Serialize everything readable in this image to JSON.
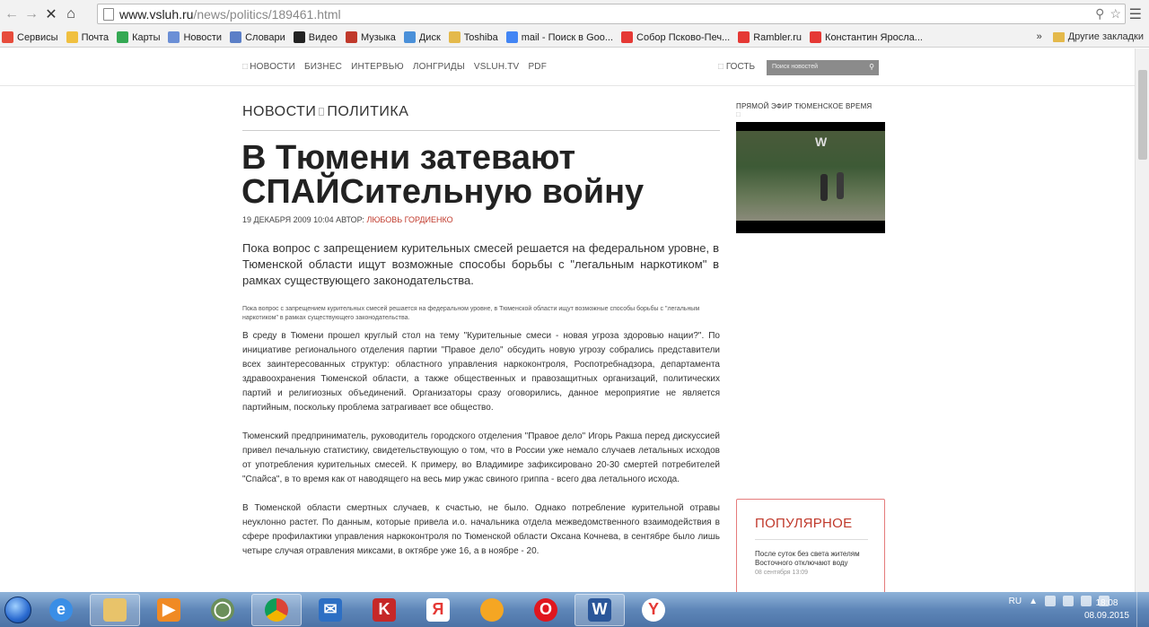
{
  "browser": {
    "url_host": "www.vsluh.ru",
    "url_path": "/news/politics/189461.html"
  },
  "bookmarks": {
    "items": [
      {
        "label": "Сервисы",
        "color": "#e74c3c"
      },
      {
        "label": "Почта",
        "color": "#f0c040"
      },
      {
        "label": "Карты",
        "color": "#34a853"
      },
      {
        "label": "Новости",
        "color": "#6b8fd6"
      },
      {
        "label": "Словари",
        "color": "#5b7fc7"
      },
      {
        "label": "Видео",
        "color": "#222222"
      },
      {
        "label": "Музыка",
        "color": "#c0392b"
      },
      {
        "label": "Диск",
        "color": "#4a90d9"
      },
      {
        "label": "Toshiba",
        "color": "#e4b94b"
      },
      {
        "label": "mail - Поиск в Goo...",
        "color": "#4285f4"
      },
      {
        "label": "Собор Псково-Печ...",
        "color": "#e53935"
      },
      {
        "label": "Rambler.ru",
        "color": "#e53935"
      },
      {
        "label": "Константин Яросла...",
        "color": "#e53935"
      }
    ],
    "overflow": "»",
    "other": "Другие закладки"
  },
  "site": {
    "nav": [
      "НОВОСТИ",
      "БИЗНЕС",
      "ИНТЕРВЬЮ",
      "ЛОНГРИДЫ",
      "VSLUH.TV",
      "PDF"
    ],
    "guest": "ГОСТЬ",
    "search_placeholder": "Поиск новостей"
  },
  "article": {
    "crumb_1": "НОВОСТИ",
    "crumb_2": "ПОЛИТИКА",
    "title": "В Тюмени затевают СПАЙСительную войну",
    "date": "19 ДЕКАБРЯ 2009 10:04 АВТОР:",
    "author": "ЛЮБОВЬ ГОРДИЕНКО",
    "lead": "Пока вопрос с запрещением курительных смесей решается на федеральном уровне, в Тюменской области ищут возможные способы борьбы с \"легальным наркотиком\" в рамках существующего законодательства.",
    "small_lead": "Пока вопрос с запрещением курительных смесей решается на федеральном уровне, в Тюменской области ищут возможные способы борьбы с \"легальным наркотиком\" в рамках существующего законодательства.",
    "p1": "В среду в Тюмени прошел круглый стол на тему \"Курительные смеси - новая угроза здоровью нации?\". По инициативе регионального отделения партии \"Правое дело\" обсудить новую угрозу собрались представители всех заинтересованных структур: областного управления наркоконтроля, Роспотребнадзора, департамента здравоохранения Тюменской области, а также общественных и правозащитных организаций, политических партий и религиозных объединений. Организаторы сразу оговорились, данное мероприятие не является партийным, поскольку проблема затрагивает все общество.",
    "p2": "Тюменский предприниматель, руководитель городского отделения \"Правое дело\" Игорь Ракша перед дискуссией привел печальную статистику, свидетельствующую о том, что в России уже немало случаев летальных исходов от употребления курительных смесей. К примеру, во Владимире зафиксировано 20-30 смертей потребителей \"Спайса\", в то время как от наводящего на весь мир ужас свиного гриппа - всего два летального исхода.",
    "p3": "В Тюменской области смертных случаев, к счастью, не было. Однако потребление курительной отравы неуклонно растет. По данным, которые привела и.о. начальника отдела межведомственного взаимодействия в сфере профилактики управления наркоконтроля по Тюменской области Оксана Кочнева, в сентябре было лишь четыре случая отравления миксами, в октябре уже 16, а в ноябре - 20."
  },
  "sidebar": {
    "live_label": "ПРЯМОЙ ЭФИР ТЮМЕНСКОЕ ВРЕМЯ",
    "video_logo": "W",
    "popular_title": "ПОПУЛЯРНОЕ",
    "popular_item": "После суток без света жителям Восточного отключают воду",
    "popular_date": "08 сентября 13:09"
  },
  "taskbar": {
    "lang": "RU",
    "time": "18:08",
    "date": "08.09.2015"
  }
}
